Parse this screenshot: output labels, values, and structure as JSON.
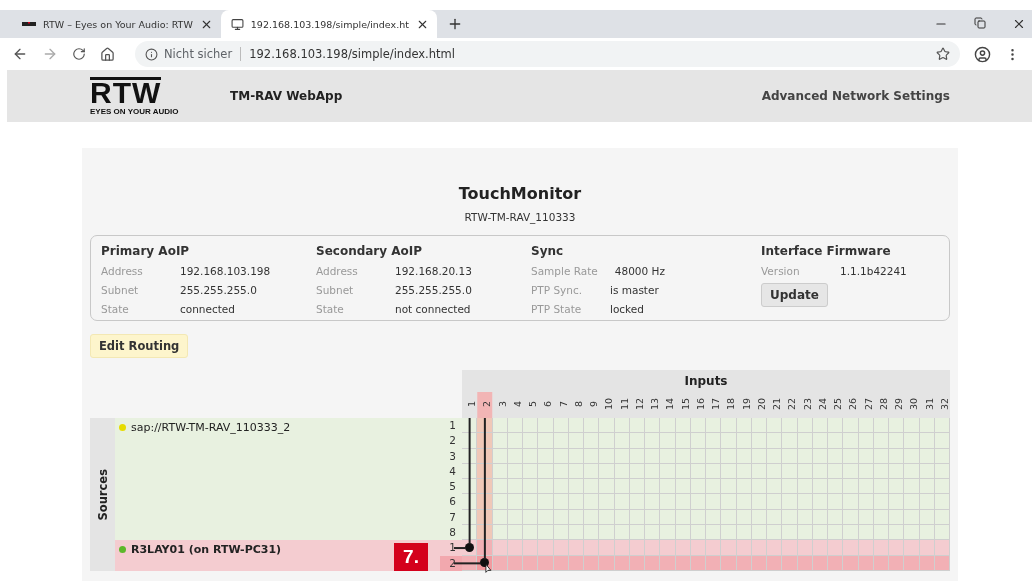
{
  "browser": {
    "tabs": [
      {
        "title": "RTW – Eyes on Your Audio: RTW",
        "selected": false,
        "kind": "logo"
      },
      {
        "title": "192.168.103.198/simple/index.ht",
        "selected": true,
        "kind": "monitor"
      }
    ],
    "security": "Nicht sicher",
    "url": "192.168.103.198/simple/index.html"
  },
  "header": {
    "logo": "RTW",
    "tagline": "EYES ON YOUR AUDIO",
    "app_title": "TM-RAV WebApp",
    "link": "Advanced Network Settings"
  },
  "device": {
    "name": "TouchMonitor",
    "id": "RTW-TM-RAV_110333"
  },
  "info_sections": [
    {
      "title": "Primary AoIP",
      "rows": [
        {
          "label": "Address",
          "value": "192.168.103.198"
        },
        {
          "label": "Subnet",
          "value": "255.255.255.0"
        },
        {
          "label": "State",
          "value": "connected"
        }
      ]
    },
    {
      "title": "Secondary AoIP",
      "rows": [
        {
          "label": "Address",
          "value": "192.168.20.13"
        },
        {
          "label": "Subnet",
          "value": "255.255.255.0"
        },
        {
          "label": "State",
          "value": "not connected"
        }
      ]
    },
    {
      "title": "Sync",
      "rows": [
        {
          "label": "Sample Rate",
          "value": "48000 Hz"
        },
        {
          "label": "PTP Sync.",
          "value": "is master"
        },
        {
          "label": "PTP State",
          "value": "locked"
        }
      ]
    },
    {
      "title": "Interface Firmware",
      "rows": [
        {
          "label": "Version",
          "value": "1.1.1b42241"
        }
      ],
      "button": "Update"
    }
  ],
  "edit_routing": "Edit Routing",
  "matrix": {
    "inputs_title": "Inputs",
    "inputs": [
      {
        "label": "1",
        "selected": false
      },
      {
        "label": "2",
        "selected": true
      },
      {
        "label": "3",
        "selected": false
      },
      {
        "label": "4",
        "selected": false
      },
      {
        "label": "5",
        "selected": false
      },
      {
        "label": "6",
        "selected": false
      },
      {
        "label": "7",
        "selected": false
      },
      {
        "label": "8",
        "selected": false
      },
      {
        "label": "9",
        "selected": false
      },
      {
        "label": "10",
        "selected": false
      },
      {
        "label": "11",
        "selected": false
      },
      {
        "label": "12",
        "selected": false
      },
      {
        "label": "13",
        "selected": false
      },
      {
        "label": "14",
        "selected": false
      },
      {
        "label": "15",
        "selected": false
      },
      {
        "label": "16",
        "selected": false
      },
      {
        "label": "17",
        "selected": false
      },
      {
        "label": "18",
        "selected": false
      },
      {
        "label": "19",
        "selected": false
      },
      {
        "label": "20",
        "selected": false
      },
      {
        "label": "21",
        "selected": false
      },
      {
        "label": "22",
        "selected": false
      },
      {
        "label": "23",
        "selected": false
      },
      {
        "label": "24",
        "selected": false
      },
      {
        "label": "25",
        "selected": false
      },
      {
        "label": "26",
        "selected": false
      },
      {
        "label": "27",
        "selected": false
      },
      {
        "label": "28",
        "selected": false
      },
      {
        "label": "29",
        "selected": false
      },
      {
        "label": "30",
        "selected": false
      },
      {
        "label": "31",
        "selected": false
      },
      {
        "label": "32",
        "selected": false
      }
    ],
    "sources_title": "Sources",
    "sources": [
      {
        "name": "sap://RTW-TM-RAV_110333_2",
        "color": "#e6dc00",
        "selected": false,
        "channels": [
          {
            "label": "1",
            "selected": false,
            "crosspoints": [
              false,
              false,
              false,
              false,
              false,
              false,
              false,
              false,
              false,
              false,
              false,
              false,
              false,
              false,
              false,
              false,
              false,
              false,
              false,
              false,
              false,
              false,
              false,
              false,
              false,
              false,
              false,
              false,
              false,
              false,
              false,
              false
            ]
          },
          {
            "label": "2",
            "selected": false,
            "crosspoints": [
              false,
              false,
              false,
              false,
              false,
              false,
              false,
              false,
              false,
              false,
              false,
              false,
              false,
              false,
              false,
              false,
              false,
              false,
              false,
              false,
              false,
              false,
              false,
              false,
              false,
              false,
              false,
              false,
              false,
              false,
              false,
              false
            ]
          },
          {
            "label": "3",
            "selected": false,
            "crosspoints": [
              false,
              false,
              false,
              false,
              false,
              false,
              false,
              false,
              false,
              false,
              false,
              false,
              false,
              false,
              false,
              false,
              false,
              false,
              false,
              false,
              false,
              false,
              false,
              false,
              false,
              false,
              false,
              false,
              false,
              false,
              false,
              false
            ]
          },
          {
            "label": "4",
            "selected": false,
            "crosspoints": [
              false,
              false,
              false,
              false,
              false,
              false,
              false,
              false,
              false,
              false,
              false,
              false,
              false,
              false,
              false,
              false,
              false,
              false,
              false,
              false,
              false,
              false,
              false,
              false,
              false,
              false,
              false,
              false,
              false,
              false,
              false,
              false
            ]
          },
          {
            "label": "5",
            "selected": false,
            "crosspoints": [
              false,
              false,
              false,
              false,
              false,
              false,
              false,
              false,
              false,
              false,
              false,
              false,
              false,
              false,
              false,
              false,
              false,
              false,
              false,
              false,
              false,
              false,
              false,
              false,
              false,
              false,
              false,
              false,
              false,
              false,
              false,
              false
            ]
          },
          {
            "label": "6",
            "selected": false,
            "crosspoints": [
              false,
              false,
              false,
              false,
              false,
              false,
              false,
              false,
              false,
              false,
              false,
              false,
              false,
              false,
              false,
              false,
              false,
              false,
              false,
              false,
              false,
              false,
              false,
              false,
              false,
              false,
              false,
              false,
              false,
              false,
              false,
              false
            ]
          },
          {
            "label": "7",
            "selected": false,
            "crosspoints": [
              false,
              false,
              false,
              false,
              false,
              false,
              false,
              false,
              false,
              false,
              false,
              false,
              false,
              false,
              false,
              false,
              false,
              false,
              false,
              false,
              false,
              false,
              false,
              false,
              false,
              false,
              false,
              false,
              false,
              false,
              false,
              false
            ]
          },
          {
            "label": "8",
            "selected": false,
            "crosspoints": [
              false,
              false,
              false,
              false,
              false,
              false,
              false,
              false,
              false,
              false,
              false,
              false,
              false,
              false,
              false,
              false,
              false,
              false,
              false,
              false,
              false,
              false,
              false,
              false,
              false,
              false,
              false,
              false,
              false,
              false,
              false,
              false
            ]
          }
        ]
      },
      {
        "name": "R3LAY01 (on RTW-PC31)",
        "color": "#5cb82a",
        "selected": true,
        "channels": [
          {
            "label": "1",
            "selected": false,
            "crosspoints": [
              true,
              false,
              false,
              false,
              false,
              false,
              false,
              false,
              false,
              false,
              false,
              false,
              false,
              false,
              false,
              false,
              false,
              false,
              false,
              false,
              false,
              false,
              false,
              false,
              false,
              false,
              false,
              false,
              false,
              false,
              false,
              false
            ]
          },
          {
            "label": "2",
            "selected": true,
            "crosspoints": [
              false,
              true,
              false,
              false,
              false,
              false,
              false,
              false,
              false,
              false,
              false,
              false,
              false,
              false,
              false,
              false,
              false,
              false,
              false,
              false,
              false,
              false,
              false,
              false,
              false,
              false,
              false,
              false,
              false,
              false,
              false,
              false
            ]
          }
        ]
      }
    ]
  },
  "annotation": "7."
}
